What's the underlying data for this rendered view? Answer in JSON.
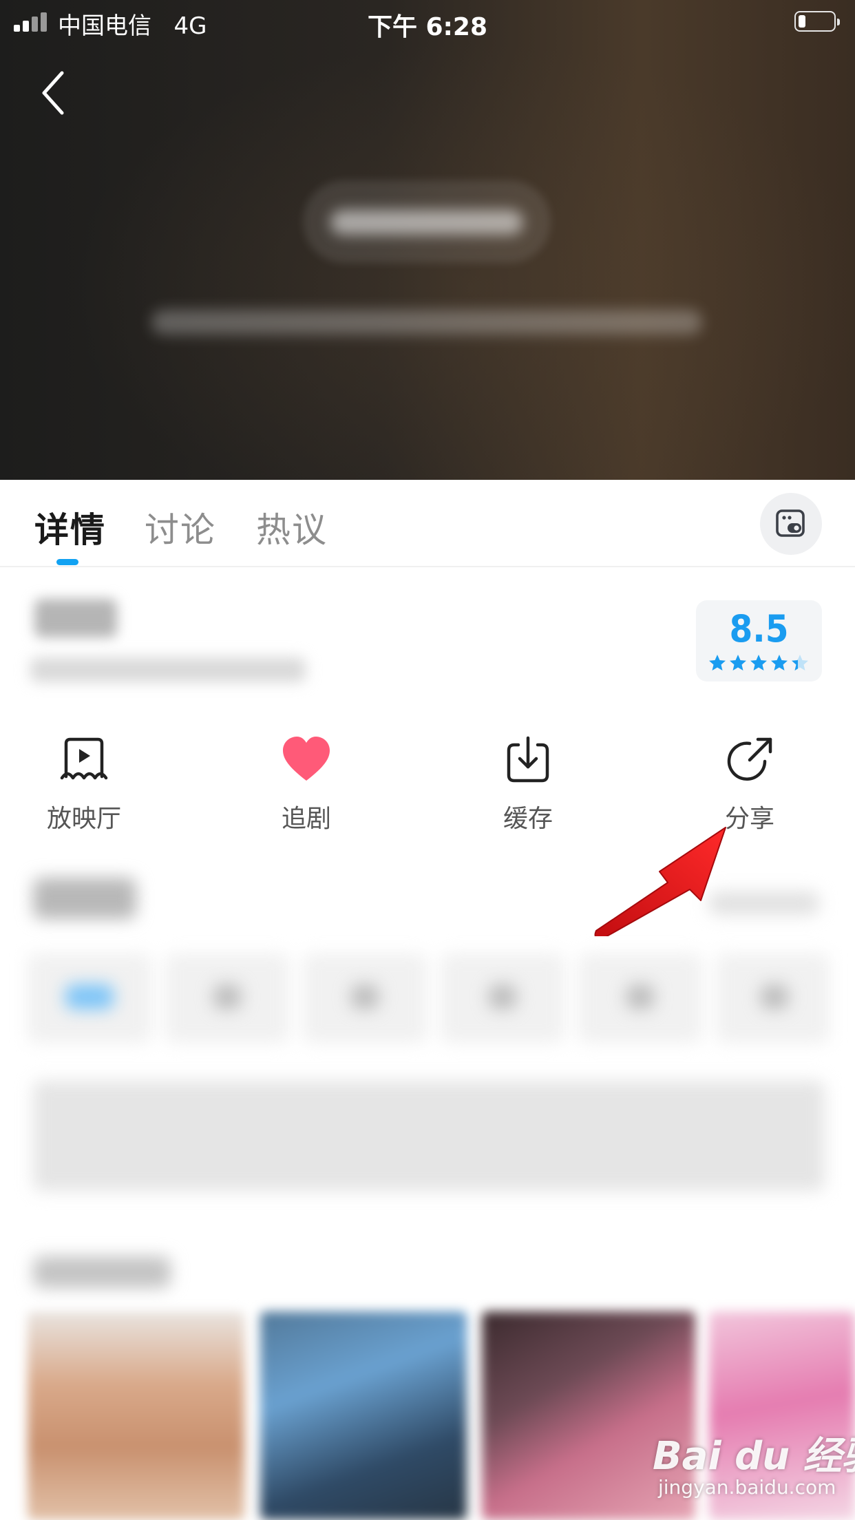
{
  "status_bar": {
    "carrier": "中国电信",
    "network": "4G",
    "time": "下午 6:28"
  },
  "tabs": [
    {
      "label": "详情",
      "active": true
    },
    {
      "label": "讨论",
      "active": false
    },
    {
      "label": "热议",
      "active": false
    }
  ],
  "rating": {
    "score": "8.5",
    "stars": 4.5,
    "max_stars": 5,
    "color": "#1a9cf0"
  },
  "actions": [
    {
      "label": "放映厅",
      "icon": "screening-room-icon"
    },
    {
      "label": "追剧",
      "icon": "heart-icon"
    },
    {
      "label": "缓存",
      "icon": "download-icon"
    },
    {
      "label": "分享",
      "icon": "share-icon"
    }
  ],
  "accent_colors": {
    "tab_indicator": "#12a2f2",
    "heart": "#ff5a78",
    "annotation_arrow": "#e8141b"
  },
  "watermark": {
    "brand": "Bai du 经验",
    "url": "jingyan.baidu.com"
  }
}
